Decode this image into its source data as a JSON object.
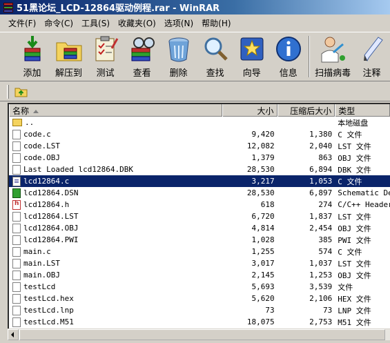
{
  "window": {
    "title": "51黑论坛_LCD-12864驱动例程.rar - WinRAR"
  },
  "menu": [
    "文件(F)",
    "命令(C)",
    "工具(S)",
    "收藏夹(O)",
    "选项(N)",
    "帮助(H)"
  ],
  "toolbar": [
    {
      "label": "添加",
      "icon": "add-books-icon"
    },
    {
      "label": "解压到",
      "icon": "extract-folder-icon"
    },
    {
      "label": "测试",
      "icon": "test-clipboard-icon"
    },
    {
      "label": "查看",
      "icon": "view-glasses-icon"
    },
    {
      "label": "删除",
      "icon": "delete-bin-icon"
    },
    {
      "label": "查找",
      "icon": "find-magnifier-icon"
    },
    {
      "label": "向导",
      "icon": "wizard-icon"
    },
    {
      "label": "信息",
      "icon": "info-icon"
    },
    {
      "label": "扫描病毒",
      "icon": "scan-virus-icon"
    },
    {
      "label": "注释",
      "icon": "comment-pen-icon"
    }
  ],
  "columns": {
    "name": "名称",
    "size": "大小",
    "packed": "压缩后大小",
    "type": "类型"
  },
  "files": [
    {
      "name": "..",
      "size": "",
      "packed": "",
      "type": "本地磁盘",
      "icon": "folder-up-icon"
    },
    {
      "name": "code.c",
      "size": "9,420",
      "packed": "1,380",
      "type": "C 文件",
      "icon": "file-icon"
    },
    {
      "name": "code.LST",
      "size": "12,082",
      "packed": "2,040",
      "type": "LST 文件",
      "icon": "file-icon"
    },
    {
      "name": "code.OBJ",
      "size": "1,379",
      "packed": "863",
      "type": "OBJ 文件",
      "icon": "file-icon"
    },
    {
      "name": "Last Loaded lcd12864.DBK",
      "size": "28,530",
      "packed": "6,894",
      "type": "DBK 文件",
      "icon": "file-icon"
    },
    {
      "name": "lcd12864.c",
      "size": "3,217",
      "packed": "1,053",
      "type": "C 文件",
      "icon": "c-source-icon",
      "selected": true
    },
    {
      "name": "lcd12864.DSN",
      "size": "28,530",
      "packed": "6,897",
      "type": "Schematic Des",
      "icon": "dsn-icon"
    },
    {
      "name": "lcd12864.h",
      "size": "618",
      "packed": "274",
      "type": "C/C++ Header",
      "icon": "header-file-icon"
    },
    {
      "name": "lcd12864.LST",
      "size": "6,720",
      "packed": "1,837",
      "type": "LST 文件",
      "icon": "file-icon"
    },
    {
      "name": "lcd12864.OBJ",
      "size": "4,814",
      "packed": "2,454",
      "type": "OBJ 文件",
      "icon": "file-icon"
    },
    {
      "name": "lcd12864.PWI",
      "size": "1,028",
      "packed": "385",
      "type": "PWI 文件",
      "icon": "file-icon"
    },
    {
      "name": "main.c",
      "size": "1,255",
      "packed": "574",
      "type": "C 文件",
      "icon": "file-icon"
    },
    {
      "name": "main.LST",
      "size": "3,017",
      "packed": "1,037",
      "type": "LST 文件",
      "icon": "file-icon"
    },
    {
      "name": "main.OBJ",
      "size": "2,145",
      "packed": "1,253",
      "type": "OBJ 文件",
      "icon": "file-icon"
    },
    {
      "name": "testLcd",
      "size": "5,693",
      "packed": "3,539",
      "type": "文件",
      "icon": "file-icon"
    },
    {
      "name": "testLcd.hex",
      "size": "5,620",
      "packed": "2,106",
      "type": "HEX 文件",
      "icon": "file-icon"
    },
    {
      "name": "testLcd.lnp",
      "size": "73",
      "packed": "73",
      "type": "LNP 文件",
      "icon": "file-icon"
    },
    {
      "name": "testLcd.M51",
      "size": "18,075",
      "packed": "2,753",
      "type": "M51 文件",
      "icon": "file-icon"
    }
  ]
}
